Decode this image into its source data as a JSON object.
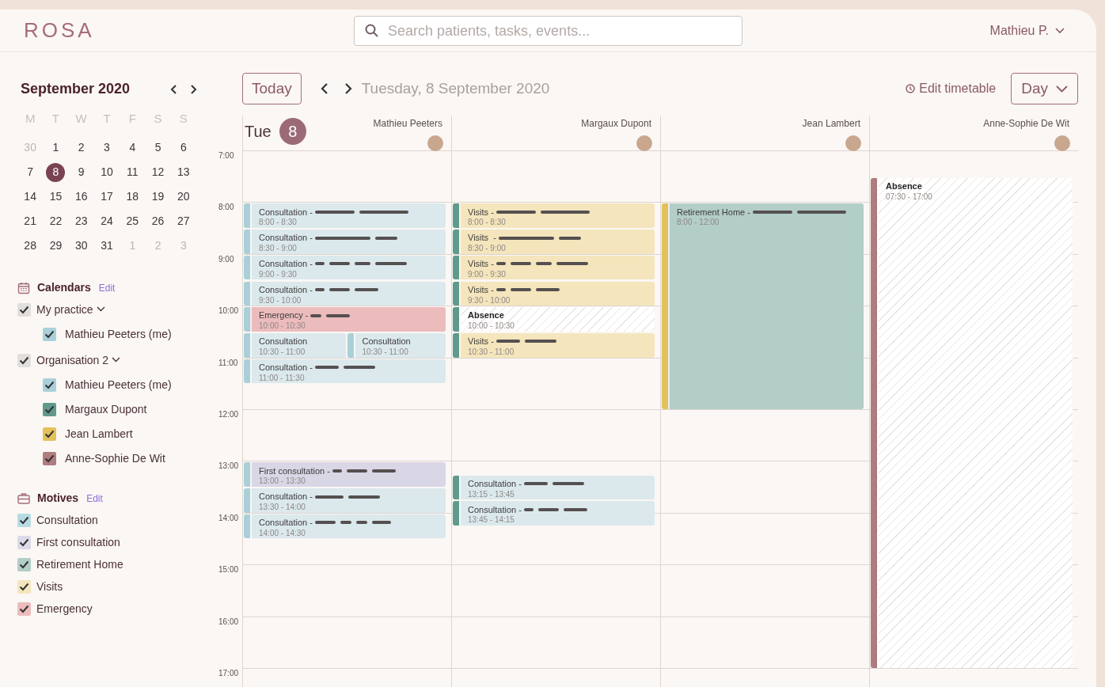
{
  "app": {
    "logo": "ROSA",
    "search": {
      "placeholder": "Search patients, tasks, events..."
    },
    "user": "Mathieu P."
  },
  "mini_calendar": {
    "title": "September 2020",
    "weekdays": [
      "M",
      "T",
      "W",
      "T",
      "F",
      "S",
      "S"
    ],
    "weeks": [
      [
        {
          "day": "30",
          "muted": true,
          "selected": false
        },
        {
          "day": "1",
          "muted": false,
          "selected": false
        },
        {
          "day": "2",
          "muted": false,
          "selected": false
        },
        {
          "day": "3",
          "muted": false,
          "selected": false
        },
        {
          "day": "4",
          "muted": false,
          "selected": false
        },
        {
          "day": "5",
          "muted": false,
          "selected": false
        },
        {
          "day": "6",
          "muted": false,
          "selected": false
        }
      ],
      [
        {
          "day": "7",
          "muted": false,
          "selected": false
        },
        {
          "day": "8",
          "muted": false,
          "selected": true
        },
        {
          "day": "9",
          "muted": false,
          "selected": false
        },
        {
          "day": "10",
          "muted": false,
          "selected": false
        },
        {
          "day": "11",
          "muted": false,
          "selected": false
        },
        {
          "day": "12",
          "muted": false,
          "selected": false
        },
        {
          "day": "13",
          "muted": false,
          "selected": false
        }
      ],
      [
        {
          "day": "14",
          "muted": false,
          "selected": false
        },
        {
          "day": "15",
          "muted": false,
          "selected": false
        },
        {
          "day": "16",
          "muted": false,
          "selected": false
        },
        {
          "day": "17",
          "muted": false,
          "selected": false
        },
        {
          "day": "18",
          "muted": false,
          "selected": false
        },
        {
          "day": "19",
          "muted": false,
          "selected": false
        },
        {
          "day": "20",
          "muted": false,
          "selected": false
        }
      ],
      [
        {
          "day": "21",
          "muted": false,
          "selected": false
        },
        {
          "day": "22",
          "muted": false,
          "selected": false
        },
        {
          "day": "23",
          "muted": false,
          "selected": false
        },
        {
          "day": "24",
          "muted": false,
          "selected": false
        },
        {
          "day": "25",
          "muted": false,
          "selected": false
        },
        {
          "day": "26",
          "muted": false,
          "selected": false
        },
        {
          "day": "27",
          "muted": false,
          "selected": false
        }
      ],
      [
        {
          "day": "28",
          "muted": false,
          "selected": false
        },
        {
          "day": "29",
          "muted": false,
          "selected": false
        },
        {
          "day": "30",
          "muted": false,
          "selected": false
        },
        {
          "day": "31",
          "muted": false,
          "selected": false
        },
        {
          "day": "1",
          "muted": true,
          "selected": false
        },
        {
          "day": "2",
          "muted": true,
          "selected": false
        },
        {
          "day": "3",
          "muted": true,
          "selected": false
        }
      ]
    ]
  },
  "calendars": {
    "title": "Calendars",
    "edit": "Edit",
    "groups": [
      {
        "label": "My practice",
        "checked": true,
        "expanded": true,
        "children": [
          {
            "label": "Mathieu Peeters (me)",
            "checked": true,
            "color": "#a9d0d9"
          }
        ]
      },
      {
        "label": "Organisation 2",
        "checked": true,
        "expanded": true,
        "children": [
          {
            "label": "Mathieu Peeters (me)",
            "checked": true,
            "color": "#a9d0d9"
          },
          {
            "label": "Margaux Dupont",
            "checked": true,
            "color": "#5f9a8c"
          },
          {
            "label": "Jean Lambert",
            "checked": true,
            "color": "#e3c15a"
          },
          {
            "label": "Anne-Sophie De Wit",
            "checked": true,
            "color": "#b07c80"
          }
        ]
      }
    ]
  },
  "motives": {
    "title": "Motives",
    "edit": "Edit",
    "items": [
      {
        "label": "Consultation",
        "checked": true,
        "color": "#b8dbe3"
      },
      {
        "label": "First consultation",
        "checked": true,
        "color": "#dcd9ea"
      },
      {
        "label": "Retirement Home",
        "checked": true,
        "color": "#b3cdc7"
      },
      {
        "label": "Visits",
        "checked": true,
        "color": "#f4e5bc"
      },
      {
        "label": "Emergency",
        "checked": true,
        "color": "#ecbcbd"
      }
    ]
  },
  "toolbar": {
    "today": "Today",
    "date": "Tuesday, 8 September 2020",
    "edit_timetable": "Edit timetable",
    "view": "Day"
  },
  "day_header": {
    "weekday": "Tue",
    "day": "8"
  },
  "hours": [
    "7:00",
    "8:00",
    "9:00",
    "10:00",
    "11:00",
    "12:00",
    "13:00",
    "14:00",
    "15:00",
    "16:00",
    "17:00"
  ],
  "columns": [
    {
      "name": "Mathieu Peeters",
      "color": "#a9d0d9",
      "events": [
        {
          "title": "Consultation -",
          "time": "8:00 - 8:30",
          "kind": "consultation",
          "redacted": true
        },
        {
          "title": "Consultation -",
          "time": "8:30 - 9:00",
          "kind": "consultation",
          "redacted": true
        },
        {
          "title": "Consultation -",
          "time": "9:00 - 9:30",
          "kind": "consultation",
          "redacted": true
        },
        {
          "title": "Consultation -",
          "time": "9:30 - 10:00",
          "kind": "consultation",
          "redacted": true
        },
        {
          "title": "Emergency -",
          "time": "10:00 - 10:30",
          "kind": "emergency",
          "redacted": true
        },
        {
          "kind": "split",
          "children": [
            {
              "title": "Consultation",
              "time": "10:30 - 11:00",
              "kind": "consultation",
              "redacted": false
            },
            {
              "title": "Consultation",
              "time": "10:30 - 11:00",
              "kind": "consultation",
              "redacted": false
            }
          ]
        },
        {
          "title": "Consultation -",
          "time": "11:00 - 11:30",
          "kind": "consultation",
          "redacted": true
        },
        {
          "title": "First consultation -",
          "time": "13:00 - 13:30",
          "kind": "first",
          "redacted": true
        },
        {
          "title": "Consultation -",
          "time": "13:30 - 14:00",
          "kind": "consultation",
          "redacted": true
        },
        {
          "title": "Consultation -",
          "time": "14:00 - 14:30",
          "kind": "consultation",
          "redacted": true
        }
      ]
    },
    {
      "name": "Margaux Dupont",
      "color": "#5f9a8c",
      "events": [
        {
          "title": "Visits -",
          "time": "8:00 - 8:30",
          "kind": "visits",
          "redacted": true
        },
        {
          "title": "Visits  -",
          "time": "8:30 - 9:00",
          "kind": "visits",
          "redacted": true
        },
        {
          "title": "Visits -",
          "time": "9:00 - 9:30",
          "kind": "visits",
          "redacted": true
        },
        {
          "title": "Visits -",
          "time": "9:30 - 10:00",
          "kind": "visits",
          "redacted": true
        },
        {
          "title": "Absence",
          "time": "10:00 - 10:30",
          "kind": "absence",
          "redacted": false
        },
        {
          "title": "Visits -",
          "time": "10:30 - 11:00",
          "kind": "visits",
          "redacted": true
        },
        {
          "title": "Consultation -",
          "time": "13:15 - 13:45",
          "kind": "consultation",
          "redacted": true
        },
        {
          "title": "Consultation -",
          "time": "13:45 - 14:15",
          "kind": "consultation",
          "redacted": true
        }
      ]
    },
    {
      "name": "Jean Lambert",
      "color": "#e3c15a",
      "events": [
        {
          "title": "Retirement Home -",
          "time": "8:00 - 12:00",
          "kind": "retirement",
          "redacted": true
        }
      ]
    },
    {
      "name": "Anne-Sophie De Wit",
      "color": "#b07c80",
      "events": [
        {
          "title": "Absence",
          "time": "07:30 - 17:00",
          "kind": "absence",
          "redacted": false
        }
      ]
    }
  ]
}
